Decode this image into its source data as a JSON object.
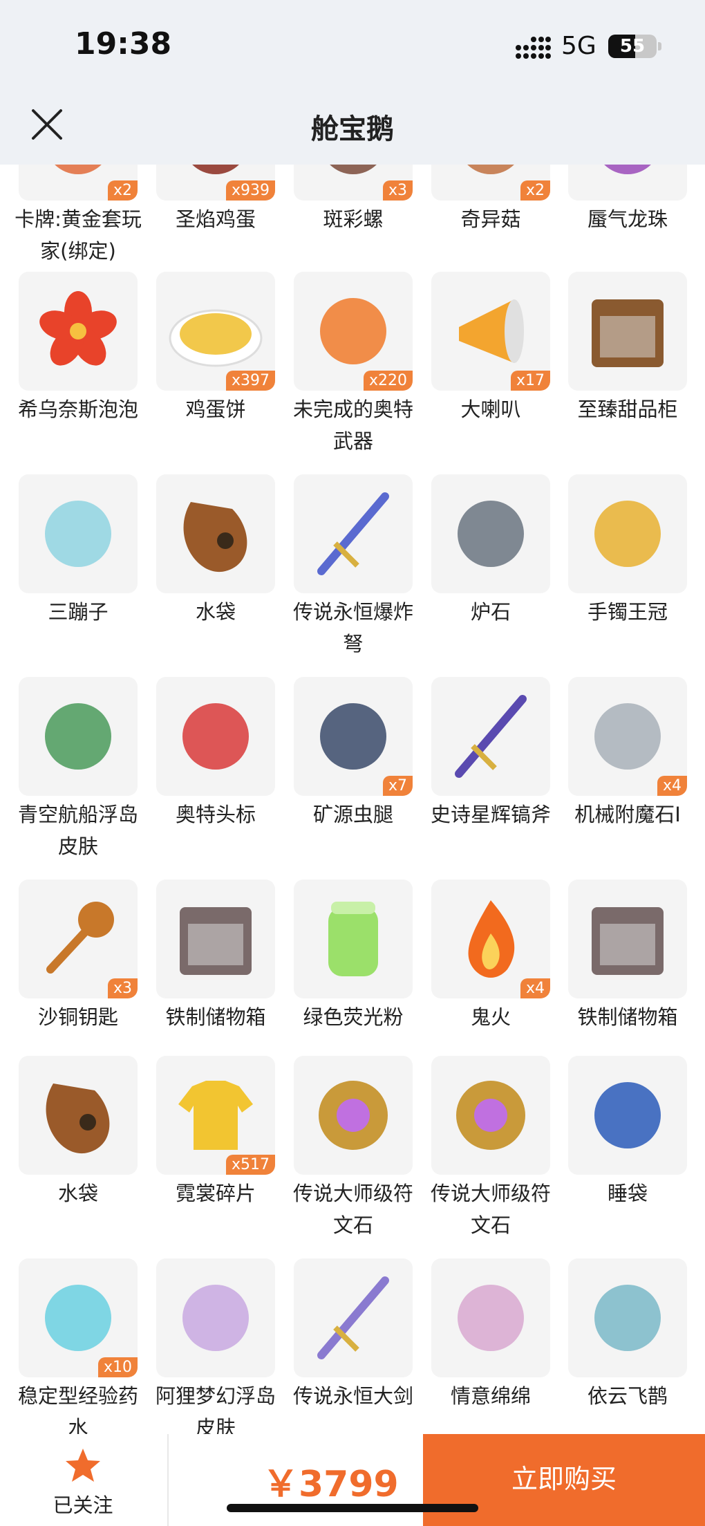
{
  "status": {
    "time": "19:38",
    "network": "5G",
    "battery": "55",
    "battery_level": 0.55
  },
  "header": {
    "title": "舱宝鹅",
    "close_icon": "close-icon"
  },
  "items": [
    {
      "name": "卡牌:黄金套玩家(绑定)",
      "qty": "x2",
      "icon": "card-icon",
      "color": "#e06a3a"
    },
    {
      "name": "圣焰鸡蛋",
      "qty": "x939",
      "icon": "egg-icon",
      "color": "#8a2a1e"
    },
    {
      "name": "斑彩螺",
      "qty": "x3",
      "icon": "shell-icon",
      "color": "#7a4a3a"
    },
    {
      "name": "奇异菇",
      "qty": "x2",
      "icon": "mushroom-icon",
      "color": "#c07040"
    },
    {
      "name": "蜃气龙珠",
      "qty": "",
      "icon": "pearl-icon",
      "color": "#9a4ab8"
    },
    {
      "name": "希乌奈斯泡泡",
      "qty": "",
      "icon": "flower-icon",
      "color": "#e8432a"
    },
    {
      "name": "鸡蛋饼",
      "qty": "x397",
      "icon": "pancake-icon",
      "color": "#f2c84b"
    },
    {
      "name": "未完成的奥特武器",
      "qty": "x220",
      "icon": "weapon-icon",
      "color": "#f07a2a"
    },
    {
      "name": "大喇叭",
      "qty": "x17",
      "icon": "megaphone-icon",
      "color": "#f3a52f"
    },
    {
      "name": "至臻甜品柜",
      "qty": "",
      "icon": "cabinet-icon",
      "color": "#8a5a30"
    },
    {
      "name": "三蹦子",
      "qty": "",
      "icon": "tricycle-icon",
      "color": "#8fd3e0"
    },
    {
      "name": "水袋",
      "qty": "",
      "icon": "waterbag-icon",
      "color": "#9a5a2a"
    },
    {
      "name": "传说永恒爆炸弩",
      "qty": "",
      "icon": "crossbow-icon",
      "color": "#5a6ad0"
    },
    {
      "name": "炉石",
      "qty": "",
      "icon": "hearthstone-icon",
      "color": "#6a7480"
    },
    {
      "name": "手镯王冠",
      "qty": "",
      "icon": "crown-icon",
      "color": "#e8b030"
    },
    {
      "name": "青空航船浮岛皮肤",
      "qty": "",
      "icon": "island-icon",
      "color": "#4a9a5a"
    },
    {
      "name": "奥特头标",
      "qty": "",
      "icon": "boomerang-icon",
      "color": "#d83a3a"
    },
    {
      "name": "矿源虫腿",
      "qty": "x7",
      "icon": "bug-leg-icon",
      "color": "#3a4a6a"
    },
    {
      "name": "史诗星辉镐斧",
      "qty": "",
      "icon": "axe-icon",
      "color": "#5a4ab0"
    },
    {
      "name": "机械附魔石I",
      "qty": "x4",
      "icon": "stone-icon",
      "color": "#a8b0b8"
    },
    {
      "name": "沙铜钥匙",
      "qty": "x3",
      "icon": "key-icon",
      "color": "#c8782a"
    },
    {
      "name": "铁制储物箱",
      "qty": "",
      "icon": "chest-icon",
      "color": "#7a6a6a"
    },
    {
      "name": "绿色荧光粉",
      "qty": "",
      "icon": "jar-icon",
      "color": "#9be06a"
    },
    {
      "name": "鬼火",
      "qty": "x4",
      "icon": "fire-icon",
      "color": "#f26a1e"
    },
    {
      "name": "铁制储物箱",
      "qty": "",
      "icon": "chest-icon",
      "color": "#7a6a6a"
    },
    {
      "name": "水袋",
      "qty": "",
      "icon": "waterbag-icon",
      "color": "#9a5a2a"
    },
    {
      "name": "霓裳碎片",
      "qty": "x517",
      "icon": "shirt-icon",
      "color": "#f2c531"
    },
    {
      "name": "传说大师级符文石",
      "qty": "",
      "icon": "rune-icon",
      "color": "#c99a3a"
    },
    {
      "name": "传说大师级符文石",
      "qty": "",
      "icon": "rune-icon",
      "color": "#c99a3a"
    },
    {
      "name": "睡袋",
      "qty": "",
      "icon": "sleeping-bag-icon",
      "color": "#2a5ab8"
    },
    {
      "name": "稳定型经验药水",
      "qty": "x10",
      "icon": "potion-icon",
      "color": "#6ad0e0"
    },
    {
      "name": "阿狸梦幻浮岛皮肤",
      "qty": "",
      "icon": "dream-island-icon",
      "color": "#c8a8e0"
    },
    {
      "name": "传说永恒大剑",
      "qty": "",
      "icon": "sword-icon",
      "color": "#8a7ad0"
    },
    {
      "name": "情意绵绵",
      "qty": "",
      "icon": "wreath-icon",
      "color": "#d8a8d0"
    },
    {
      "name": "依云飞鹊",
      "qty": "",
      "icon": "drone-icon",
      "color": "#7ab8c8"
    }
  ],
  "bottom": {
    "follow_label": "已关注",
    "follow_icon": "star-icon",
    "price": "￥3799",
    "buy_label": "立即购买",
    "accent": "#f06c2c"
  }
}
